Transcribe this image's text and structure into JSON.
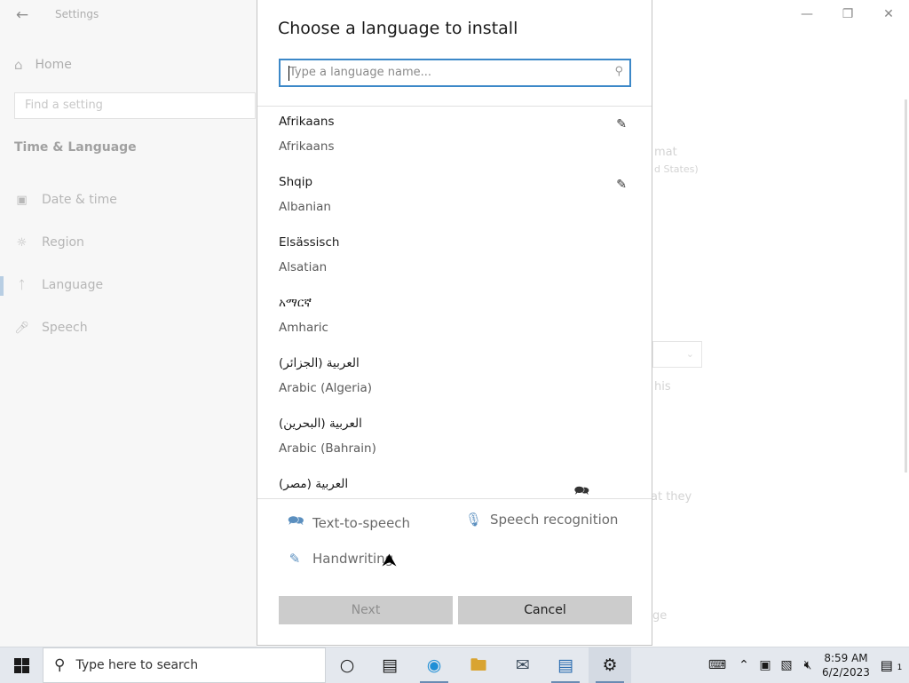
{
  "settings": {
    "window_title": "Settings",
    "home_label": "Home",
    "search_placeholder": "Find a setting",
    "section_title": "Time & Language",
    "nav_items": [
      {
        "label": "Date & time"
      },
      {
        "label": "Region"
      },
      {
        "label": "Language"
      },
      {
        "label": "Speech"
      }
    ],
    "bg_fragments": {
      "format": "mat",
      "format_value": "d States)",
      "this": "his",
      "they": "at they",
      "ge": "ge"
    },
    "window_controls": {
      "minimize": "—",
      "restore": "❐",
      "close": "✕"
    }
  },
  "dialog": {
    "title": "Choose a language to install",
    "search_placeholder": "Type a language name...",
    "languages": [
      {
        "native": "Afrikaans",
        "english": "Afrikaans",
        "feature_icon": "handwriting-icon"
      },
      {
        "native": "Shqip",
        "english": "Albanian",
        "feature_icon": "handwriting-icon"
      },
      {
        "native": "Elsässisch",
        "english": "Alsatian",
        "feature_icon": ""
      },
      {
        "native": "አማርኛ",
        "english": "Amharic",
        "feature_icon": ""
      },
      {
        "native": "العربية (الجزائر)",
        "english": "Arabic (Algeria)",
        "feature_icon": ""
      },
      {
        "native": "العربية (البحرين)",
        "english": "Arabic (Bahrain)",
        "feature_icon": ""
      },
      {
        "native": "العربية (مصر)",
        "english": "",
        "feature_icon": "text-to-speech-icon"
      }
    ],
    "legend": {
      "tts": "Text-to-speech",
      "speech": "Speech recognition",
      "handwriting": "Handwriting"
    },
    "buttons": {
      "next": "Next",
      "cancel": "Cancel"
    }
  },
  "taskbar": {
    "search_placeholder": "Type here to search",
    "time": "8:59 AM",
    "date": "6/2/2023",
    "notification_count": "1"
  },
  "colors": {
    "accent": "#3c88c8",
    "taskbar_bg": "#e4e8ee",
    "nav_bg": "#f0f0f0"
  }
}
